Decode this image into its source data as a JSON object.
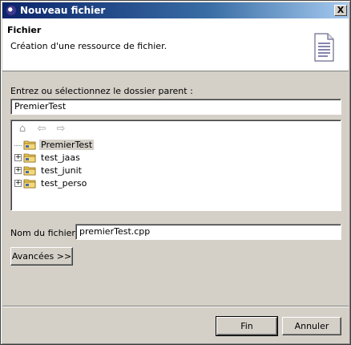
{
  "window": {
    "title": "Nouveau fichier",
    "close_label": "X"
  },
  "banner": {
    "title": "Fichier",
    "description": "Création d'une ressource de fichier."
  },
  "parent": {
    "label": "Entrez ou sélectionnez le dossier parent :",
    "value": "PremierTest"
  },
  "tree": {
    "items": [
      {
        "label": "PremierTest",
        "expandable": false,
        "selected": true
      },
      {
        "label": "test_jaas",
        "expandable": true,
        "selected": false
      },
      {
        "label": "test_junit",
        "expandable": true,
        "selected": false
      },
      {
        "label": "test_perso",
        "expandable": true,
        "selected": false
      }
    ]
  },
  "filename": {
    "label": "Nom du fichier :",
    "value": "premierTest.cpp"
  },
  "buttons": {
    "advanced": "Avancées >>",
    "finish": "Fin",
    "cancel": "Annuler"
  },
  "icons": {
    "app": "eclipse-icon",
    "close": "close-icon",
    "banner": "file-icon",
    "home": "home-icon",
    "back": "arrow-left-icon",
    "forward": "arrow-right-icon",
    "folder": "project-folder-icon"
  }
}
